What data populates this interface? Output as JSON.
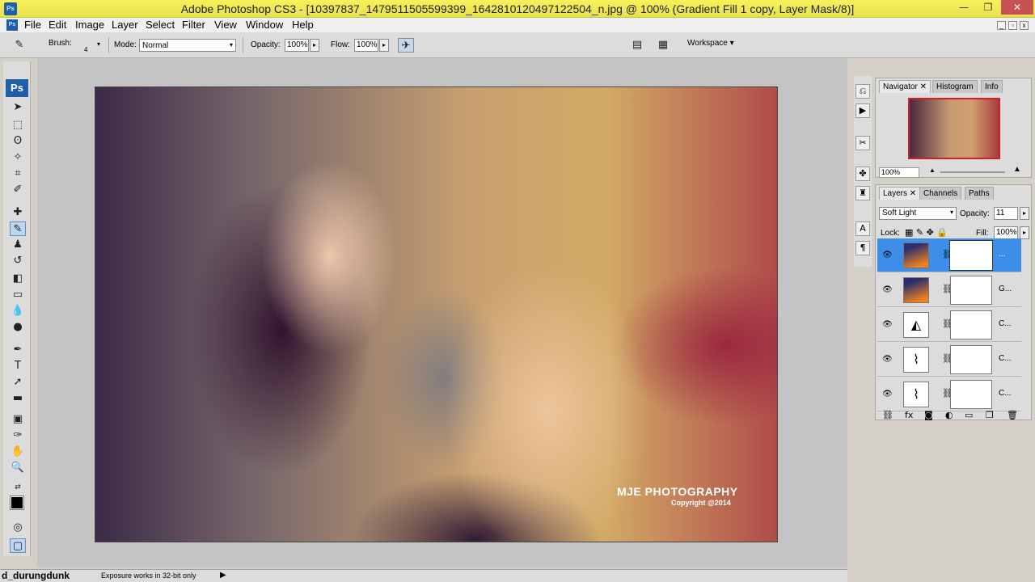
{
  "window": {
    "app_icon": "Ps",
    "title": "Adobe Photoshop CS3 - [10397837_1479511505599399_1642810120497122504_n.jpg @ 100% (Gradient Fill 1 copy, Layer Mask/8)]",
    "minimize_glyph": "—",
    "maximize_glyph": "❐",
    "close_glyph": "✕"
  },
  "menu": {
    "items": [
      "File",
      "Edit",
      "Image",
      "Layer",
      "Select",
      "Filter",
      "View",
      "Window",
      "Help"
    ]
  },
  "options": {
    "brush_label": "Brush:",
    "brush_size": "4",
    "mode_label": "Mode:",
    "mode_value": "Normal",
    "opacity_label": "Opacity:",
    "opacity_value": "100%",
    "flow_label": "Flow:",
    "flow_value": "100%",
    "workspace_label": "Workspace ▾"
  },
  "toolbox": {
    "logo": "Ps",
    "tools": [
      "move-tool",
      "marquee-tool",
      "lasso-tool",
      "magic-wand-tool",
      "crop-tool",
      "eyedropper-tool",
      "healing-tool",
      "brush-tool",
      "clone-stamp-tool",
      "history-brush-tool",
      "eraser-tool",
      "gradient-tool",
      "blur-tool",
      "dodge-tool",
      "pen-tool",
      "type-tool",
      "path-select-tool",
      "shape-tool",
      "notes-tool",
      "eyedropper2-tool",
      "hand-tool",
      "zoom-tool"
    ]
  },
  "canvas": {
    "watermark_line1": "MJE PHOTOGRAPHY",
    "watermark_line2": "Copyright @2014"
  },
  "statusbar": {
    "zoom_text": "d_durungdunk",
    "message": "Exposure works in 32-bit only",
    "play_glyph": "▶"
  },
  "navigator": {
    "tabs": [
      "Navigator",
      "Histogram",
      "Info"
    ],
    "zoom": "100%"
  },
  "layers": {
    "tabs": [
      "Layers",
      "Channels",
      "Paths"
    ],
    "blend_mode": "Soft Light",
    "opacity_label": "Opacity:",
    "opacity_value": "11",
    "lock_label": "Lock:",
    "fill_label": "Fill:",
    "fill_value": "100%",
    "rows": [
      {
        "name": "...",
        "thumb": "gradient",
        "selected": true
      },
      {
        "name": "G...",
        "thumb": "gradient",
        "selected": false
      },
      {
        "name": "C...",
        "thumb": "levels",
        "selected": false
      },
      {
        "name": "C...",
        "thumb": "curves",
        "selected": false
      },
      {
        "name": "C...",
        "thumb": "curves",
        "selected": false
      }
    ]
  }
}
